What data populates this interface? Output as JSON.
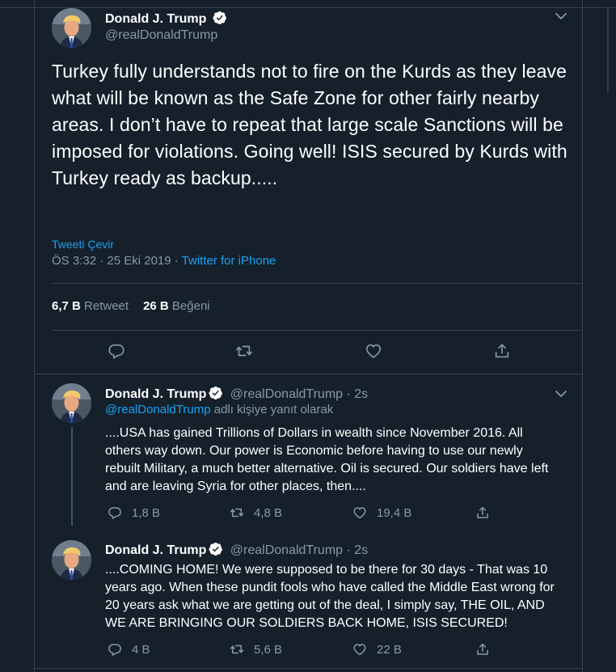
{
  "main_tweet": {
    "author_name": "Donald J. Trump",
    "author_handle": "@realDonaldTrump",
    "text": "Turkey fully understands not to fire on the Kurds as they leave what will be known as the Safe Zone for other fairly nearby areas. I don’t have to repeat that large scale Sanctions will be imposed for violations. Going well! ISIS secured by Kurds with Turkey ready as backup.....",
    "translate_label": "Tweeti Çevir",
    "time": "ÖS 3:32 · 25 Eki 2019 · ",
    "source": "Twitter for iPhone",
    "retweets_count": "6,7 B",
    "retweets_label": "Retweet",
    "likes_count": "26 B",
    "likes_label": "Beğeni"
  },
  "replies": [
    {
      "author_name": "Donald J. Trump",
      "author_handle": "@realDonaldTrump · 2s",
      "reply_mention": "@realDonaldTrump",
      "reply_suffix": " adlı kişiye yanıt olarak",
      "text": "....USA has gained Trillions of Dollars in wealth since November 2016. All others way down. Our power is Economic before having to use our newly rebuilt Military, a much better alternative. Oil is secured. Our soldiers have left and are leaving Syria for other places, then....",
      "replies": "1,8 B",
      "retweets": "4,8 B",
      "likes": "19,4 B"
    },
    {
      "author_name": "Donald J. Trump",
      "author_handle": "@realDonaldTrump · 2s",
      "text": "....COMING HOME! We were supposed to be there for 30 days - That was 10 years ago. When these pundit fools who have called the Middle East wrong for 20 years ask what we are getting out of the deal, I simply say, THE OIL, AND WE ARE BRINGING OUR SOLDIERS BACK HOME, ISIS SECURED!",
      "replies": "4 B",
      "retweets": "5,6 B",
      "likes": "22 B"
    }
  ],
  "icons": [
    "avatar-photo",
    "verified-badge-icon",
    "chevron-down-icon",
    "reply-icon",
    "retweet-icon",
    "like-icon",
    "share-icon"
  ],
  "colors": {
    "background": "#15202b",
    "border": "#38444d",
    "accent": "#1da1f2",
    "secondary_text": "#8899a6",
    "primary_text": "#ffffff"
  }
}
